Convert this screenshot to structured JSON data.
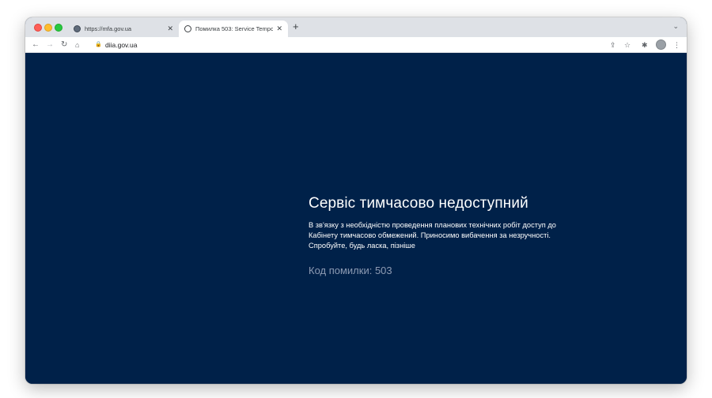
{
  "browser": {
    "tabs": [
      {
        "title": "https://mfa.gov.ua",
        "close": "✕",
        "favicon": "gov-emblem-icon",
        "active": false
      },
      {
        "title": "Помилка 503: Service Tempor",
        "close": "✕",
        "favicon": "globe-icon",
        "active": true
      }
    ],
    "new_tab": "+",
    "tab_menu": "⌄",
    "address": "diia.gov.ua",
    "icons": {
      "back": "←",
      "forward": "→",
      "reload": "↻",
      "home": "⌂",
      "lock": "🔒",
      "share": "⇪",
      "star": "☆",
      "extensions": "✱",
      "menu": "⋮"
    }
  },
  "page": {
    "title": "Сервіс тимчасово недоступний",
    "message": "В зв'язку з необхідністю проведення планових технічних робіт доступ до Кабінету тимчасово обмежений. Приносимо вибачення за незручності. Спробуйте, будь ласка, пізніше",
    "error_code": "Код помилки: 503"
  },
  "colors": {
    "page_background": "#002149",
    "tabstrip": "#dee1e6",
    "error_code_text": "#8d9bb3"
  }
}
